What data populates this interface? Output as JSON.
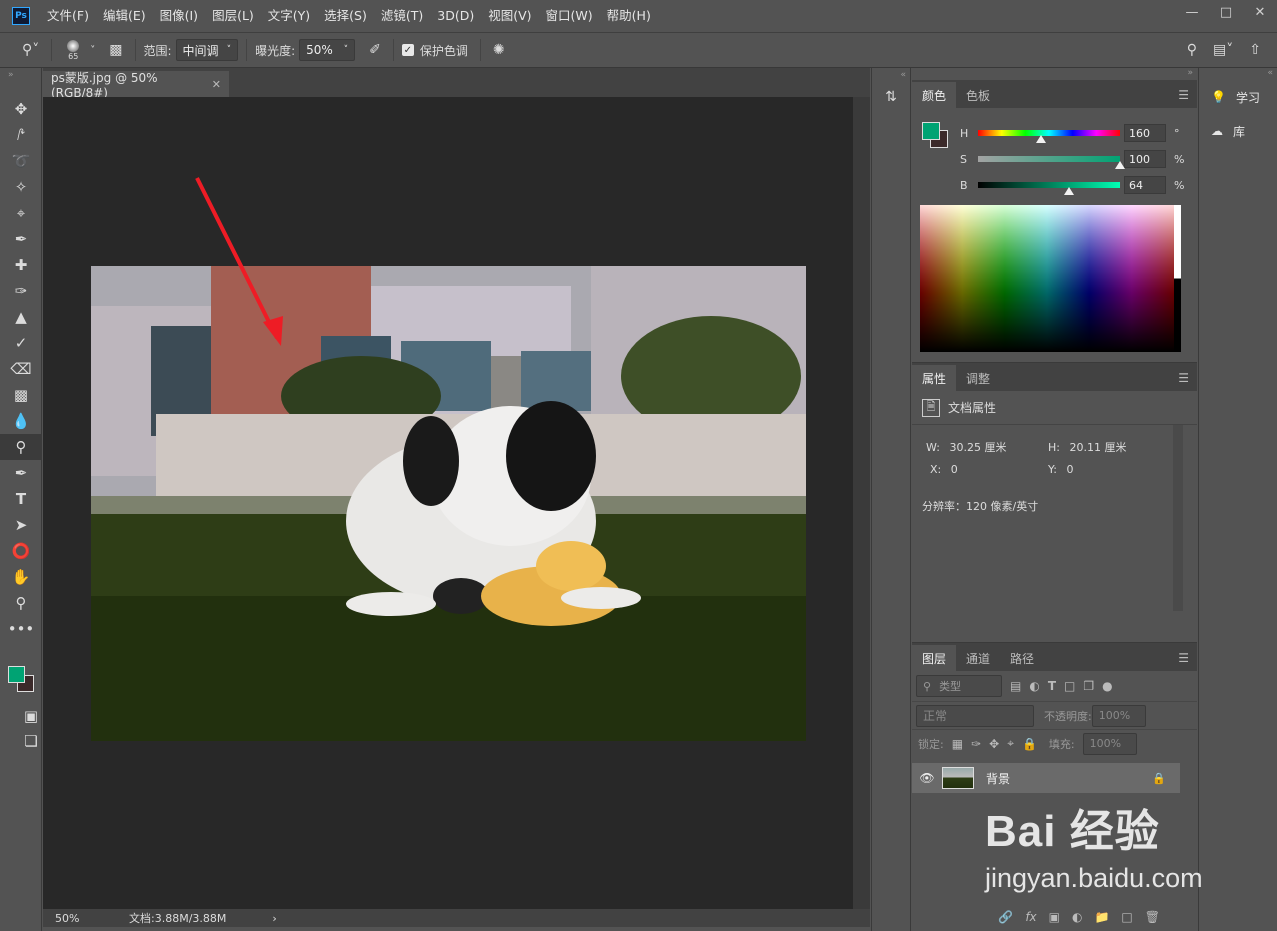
{
  "app": {
    "logo": "Ps",
    "menu": [
      "文件(F)",
      "编辑(E)",
      "图像(I)",
      "图层(L)",
      "文字(Y)",
      "选择(S)",
      "滤镜(T)",
      "3D(D)",
      "视图(V)",
      "窗口(W)",
      "帮助(H)"
    ]
  },
  "options": {
    "brush_size": "65",
    "range_label": "范围:",
    "range_value": "中间调",
    "exposure_label": "曝光度:",
    "exposure_value": "50%",
    "protect_tones_label": "保护色调",
    "protect_tones_checked": true
  },
  "document": {
    "tab_title": "ps蒙版.jpg @ 50%(RGB/8#)",
    "zoom": "50%",
    "doc_size": "文档:3.88M/3.88M"
  },
  "color_panel": {
    "tabs": [
      "颜色",
      "色板"
    ],
    "fg_color": "#00a373",
    "h_label": "H",
    "h_value": "160",
    "h_unit": "°",
    "h_level": 160,
    "s_label": "S",
    "s_value": "100",
    "s_unit": "%",
    "s_level": 100,
    "b_label": "B",
    "b_value": "64",
    "b_unit": "%",
    "b_level": 64
  },
  "properties_panel": {
    "tabs": [
      "属性",
      "调整"
    ],
    "title": "文档属性",
    "w_label": "W:",
    "w_value": "30.25 厘米",
    "h_label": "H:",
    "h_value": "20.11 厘米",
    "x_label": "X:",
    "x_value": "0",
    "y_label": "Y:",
    "y_value": "0",
    "resolution": "分辨率：120 像素/英寸"
  },
  "layers_panel": {
    "tabs": [
      "图层",
      "通道",
      "路径"
    ],
    "filter_placeholder": "类型",
    "blend_mode": "正常",
    "opacity_label": "不透明度:",
    "opacity_value": "100%",
    "lock_label": "锁定:",
    "fill_label": "填充:",
    "fill_value": "100%",
    "layer_name": "背景"
  },
  "learn_panel": {
    "items": [
      "学习",
      "库"
    ]
  },
  "watermark": {
    "brand": "Bai 经验",
    "url": "jingyan.baidu.com"
  }
}
